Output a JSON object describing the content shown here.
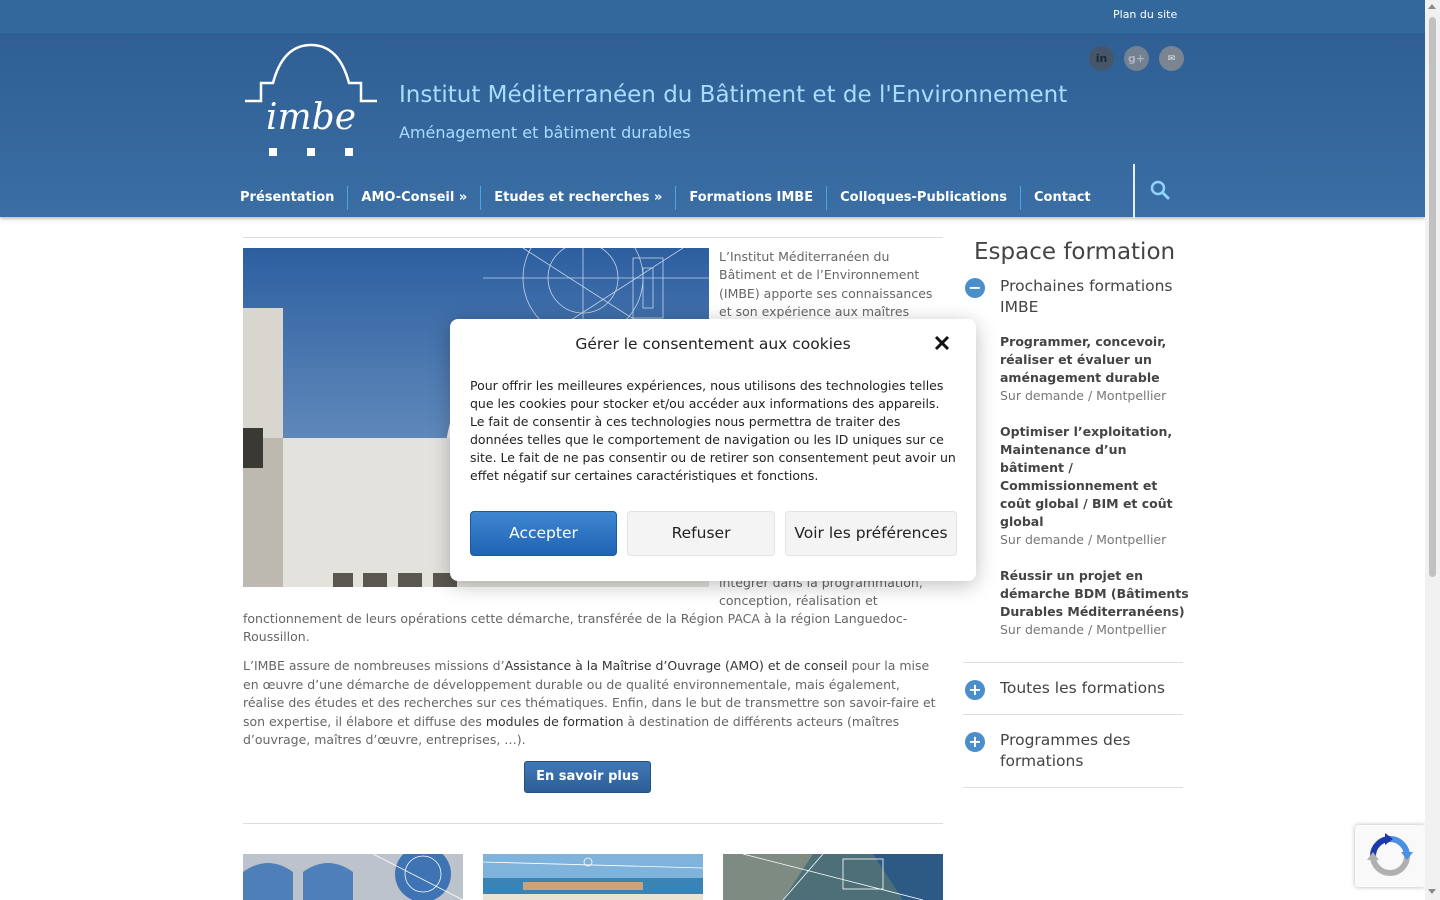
{
  "topbar": {
    "sitemap_label": "Plan du site"
  },
  "header": {
    "site_title": "Institut Méditerranéen du Bâtiment et de l'Environnement",
    "tagline": "Aménagement et bâtiment durables",
    "logo_text": "imbe",
    "social": [
      {
        "icon": "linkedin-icon",
        "glyph": "in"
      },
      {
        "icon": "google-plus-icon",
        "glyph": "g+"
      },
      {
        "icon": "email-icon",
        "glyph": "✉"
      }
    ]
  },
  "nav": {
    "items": [
      {
        "label": "Présentation"
      },
      {
        "label": "AMO-Conseil  »"
      },
      {
        "label": "Etudes et recherches  »"
      },
      {
        "label": "Formations IMBE"
      },
      {
        "label": "Colloques-Publications"
      },
      {
        "label": "Contact"
      }
    ]
  },
  "main": {
    "intro_col": "L’Institut Méditerranéen du Bâtiment et de l’Environnement (IMBE) apporte ses connaissances et son expérience aux maîtres d’ouvrage",
    "intro_tail": "intégrer dans la programmation, conception, réalisation et",
    "intro_full": "fonctionnement de leurs opérations cette démarche, transférée de la Région PACA à la région Languedoc-Roussillon.",
    "para2_a": "L’IMBE assure de nombreuses missions d’",
    "para2_link1": "Assistance à la Maîtrise d’Ouvrage (AMO) et de conseil",
    "para2_b": " pour la mise en œuvre d’une démarche de développement durable ou de qualité environnementale, mais également, réalise des études et des recherches sur ces thématiques. Enfin, dans le but de transmettre son savoir-faire et son expertise, il élabore et diffuse des ",
    "para2_link2": "modules de formation",
    "para2_c": " à destination de différents acteurs (maîtres d’ouvrage, maîtres d’œuvre, entreprises, …).",
    "more_button": "En savoir plus"
  },
  "sidebar": {
    "title": "Espace formation",
    "sections": [
      {
        "label": "Prochaines formations IMBE",
        "state": "expanded",
        "icon": "minus-icon",
        "glyph": "−"
      },
      {
        "label": "Toutes les formations",
        "state": "collapsed",
        "icon": "plus-icon",
        "glyph": "+"
      },
      {
        "label": "Programmes des formations",
        "state": "collapsed",
        "icon": "plus-icon",
        "glyph": "+"
      }
    ],
    "formations": [
      {
        "title": "Programmer, concevoir, réaliser et évaluer un aménagement durable",
        "meta": "Sur demande / Montpellier"
      },
      {
        "title": "Optimiser l’exploitation, Maintenance d’un bâtiment / Commissionnement et coût global / BIM et coût global",
        "meta": "Sur demande / Montpellier"
      },
      {
        "title": "Réussir un projet en démarche BDM (Bâtiments Durables Méditerranéens)",
        "meta": "Sur demande / Montpellier"
      }
    ]
  },
  "cookie_modal": {
    "title": "Gérer le consentement aux cookies",
    "body": "Pour offrir les meilleures expériences, nous utilisons des technologies telles que les cookies pour stocker et/ou accéder aux informations des appareils. Le fait de consentir à ces technologies nous permettra de traiter des données telles que le comportement de navigation ou les ID uniques sur ce site. Le fait de ne pas consentir ou de retirer son consentement peut avoir un effet négatif sur certaines caractéristiques et fonctions.",
    "accept_label": "Accepter",
    "refuse_label": "Refuser",
    "prefs_label": "Voir les préférences"
  },
  "colors": {
    "header_blue": "#33689c",
    "title_light_blue": "#a9dcff",
    "accent_blue": "#4a8fcc",
    "accept_blue": "#1e64b3"
  }
}
